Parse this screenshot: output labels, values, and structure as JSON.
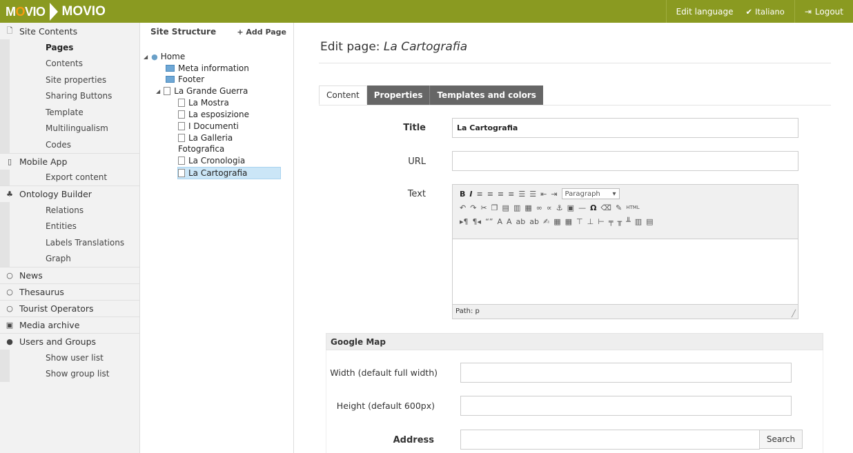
{
  "app": {
    "logo_prefix": "M",
    "logo_o": "O",
    "logo_suffix": "VIO",
    "logo_name": "MOVIO",
    "accent": "#8a9a21"
  },
  "topbar": {
    "edit_language": "Edit language",
    "language": "Italiano",
    "logout": "Logout"
  },
  "sidebar": {
    "site_contents": "Site Contents",
    "site_items": [
      "Pages",
      "Contents",
      "Site properties",
      "Sharing Buttons",
      "Template",
      "Multilingualism",
      "Codes"
    ],
    "mobile_app": "Mobile App",
    "mobile_items": [
      "Export content"
    ],
    "ontology_builder": "Ontology Builder",
    "ontology_items": [
      "Relations",
      "Entities",
      "Labels Translations",
      "Graph"
    ],
    "news": "News",
    "thesaurus": "Thesaurus",
    "tourist_operators": "Tourist Operators",
    "media_archive": "Media archive",
    "users_groups": "Users and Groups",
    "users_items": [
      "Show user list",
      "Show group list"
    ]
  },
  "tree": {
    "title": "Site Structure",
    "add_page": "+ Add Page",
    "home": "Home",
    "meta": "Meta information",
    "footer": "Footer",
    "grande_guerra": "La Grande Guerra",
    "mostra": "La Mostra",
    "esposizione": "La esposizione",
    "documenti": "I Documenti",
    "galleria": "La Galleria",
    "fotografica": "Fotografica",
    "cronologia": "La Cronologia",
    "cartografia": "La Cartografia"
  },
  "main": {
    "title_prefix": "Edit page: ",
    "title_page": "La Cartografia",
    "tabs": [
      "Content",
      "Properties",
      "Templates and colors"
    ],
    "title_label": "Title",
    "title_value": "La Cartografia",
    "url_label": "URL",
    "url_value": "",
    "text_label": "Text",
    "paragraph": "Paragraph",
    "path": "Path: p",
    "gm_header": "Google Map",
    "width_label": "Width (default full width)",
    "height_label": "Height (default 600px)",
    "address_label": "Address",
    "search_btn": "Search"
  }
}
